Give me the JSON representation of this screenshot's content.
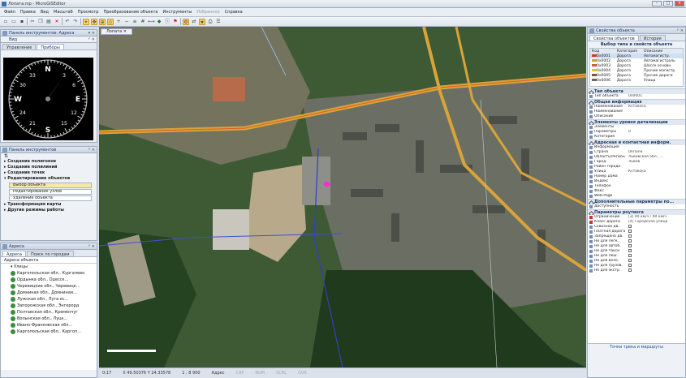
{
  "window": {
    "title": "Лопата.mp - MicroGISEditor"
  },
  "menu": [
    "Файл",
    "Правка",
    "Вид",
    "Масштаб",
    "Просмотр",
    "Преобразование объекта",
    "Инструменты",
    "Избранное",
    "Справка"
  ],
  "left": {
    "nav_panel_title": "Панель инструментов: Адреса",
    "nav_subtitle": "Вид",
    "nav_tabs": [
      "Управление",
      "Приборы"
    ],
    "compass": {
      "labels": [
        "N",
        "E",
        "S",
        "W",
        "3",
        "6",
        "12",
        "15",
        "21",
        "24",
        "30",
        "33"
      ]
    },
    "tools_title": "Панель инструментов",
    "tools": {
      "items": [
        "Создание полигонов",
        "Создание полилиний",
        "Создание точек",
        "Редактирование объектов"
      ],
      "subitems": [
        "Выбор объекта",
        "Редактирование узлов",
        "Удаление объекта"
      ],
      "more": [
        "Трансформация карты",
        "Другие режимы работы"
      ]
    },
    "addr_title": "Адреса",
    "addr_tabs": [
      "Адреса",
      "Поиск по городам"
    ],
    "addr_header": "Адреса объекта",
    "addr_root": "Улицы",
    "addr_items": [
      "Каргопольская обл., Кургалево",
      "Ордынка обл., Одесск...",
      "Черевицкие обл., Черевицк...",
      "Домниная обл., Домниная...",
      "Лужская обл., Луга кс...",
      "Запорожская обл., Энгерорд",
      "Полтавская обл., Кременчуг",
      "Волынская обл., Луцк...",
      "Ивано-Франковская обл...",
      "Каргопольская обл., Каргоп..."
    ]
  },
  "map": {
    "tab_label": "Лопата",
    "status": [
      "0:17",
      "X 49.50376 Y 24.33578",
      "1 : 8 900",
      "Адрес"
    ],
    "status_dim": [
      "CAP",
      "NUM",
      "SCRL",
      "OVR"
    ]
  },
  "right": {
    "title": "Свойства объекта",
    "tabs": [
      "Свойства объектов",
      "История"
    ],
    "type_header": "Выбор типа и свойств объекта",
    "table_headers": [
      "Код",
      "Категория",
      "Описание"
    ],
    "type_rows": [
      {
        "code": "0x0001",
        "cat": "Дорога",
        "desc": "Автомагистр.",
        "color": "#d23b1e"
      },
      {
        "code": "0x0002",
        "cat": "Дорога",
        "desc": "Автомагистраль",
        "color": "#e0962a"
      },
      {
        "code": "0x0003",
        "cat": "Дорога",
        "desc": "Шоссе основн.",
        "color": "#c9632e"
      },
      {
        "code": "0x0004",
        "cat": "Дорога",
        "desc": "Прочие магистр.",
        "color": "#e3c227"
      },
      {
        "code": "0x0005",
        "cat": "Дорога",
        "desc": "Прочие дороги",
        "color": "#7a5a2e"
      },
      {
        "code": "0x0006",
        "cat": "Дорога",
        "desc": "Улица",
        "color": "#666666"
      }
    ],
    "sections": [
      {
        "title": "Тип объекта",
        "rows": [
          [
            "Тип объекта",
            "0x0001"
          ]
        ]
      },
      {
        "title": "Общая информация",
        "rows": [
          [
            "Наименование",
            "Кстовска"
          ],
          [
            "Наименование",
            ""
          ],
          [
            "Описание",
            ""
          ]
        ]
      },
      {
        "title": "Элементы уровня детализации",
        "rows": [
          [
            "Элементы",
            ""
          ],
          [
            "Параметры",
            "0"
          ],
          [
            "Категория",
            ""
          ]
        ]
      },
      {
        "title": "Адресная и контактная информ.",
        "rows": [
          [
            "Информация",
            ""
          ],
          [
            "Страна",
            "Ukraine"
          ],
          [
            "Область/Регион",
            "Львовская обл., ..."
          ],
          [
            "Город",
            "Львов"
          ],
          [
            "Район города",
            ""
          ],
          [
            "Улица",
            "Кстовска"
          ],
          [
            "Номер дома",
            ""
          ],
          [
            "Индекс",
            ""
          ],
          [
            "Телефон",
            ""
          ],
          [
            "Факс",
            ""
          ],
          [
            "Web-Page",
            ""
          ]
        ]
      },
      {
        "title": "Дополнительные параметры по...",
        "rows": [
          [
            "Доступность",
            ""
          ]
        ]
      },
      {
        "title": "Параметры роутинга",
        "rows": [
          [
            "Ограничение",
            "[3] 40 км/ч / 90 км/ч"
          ],
          [
            "Класс дороги",
            "[4] Городская улица"
          ],
          [
            "Сквозное дв.",
            ""
          ],
          [
            "Платная дорога",
            ""
          ],
          [
            "Запрещено дв.",
            ""
          ],
          [
            "Не для легк.",
            ""
          ],
          [
            "Не для автоб.",
            ""
          ],
          [
            "Не для такси",
            ""
          ],
          [
            "Не для пеш.",
            ""
          ],
          [
            "Не для вело.",
            ""
          ],
          [
            "Не для грузов.",
            ""
          ],
          [
            "Не для экстр.",
            ""
          ]
        ]
      }
    ],
    "footer_link": "Точки трека и маршруты"
  }
}
